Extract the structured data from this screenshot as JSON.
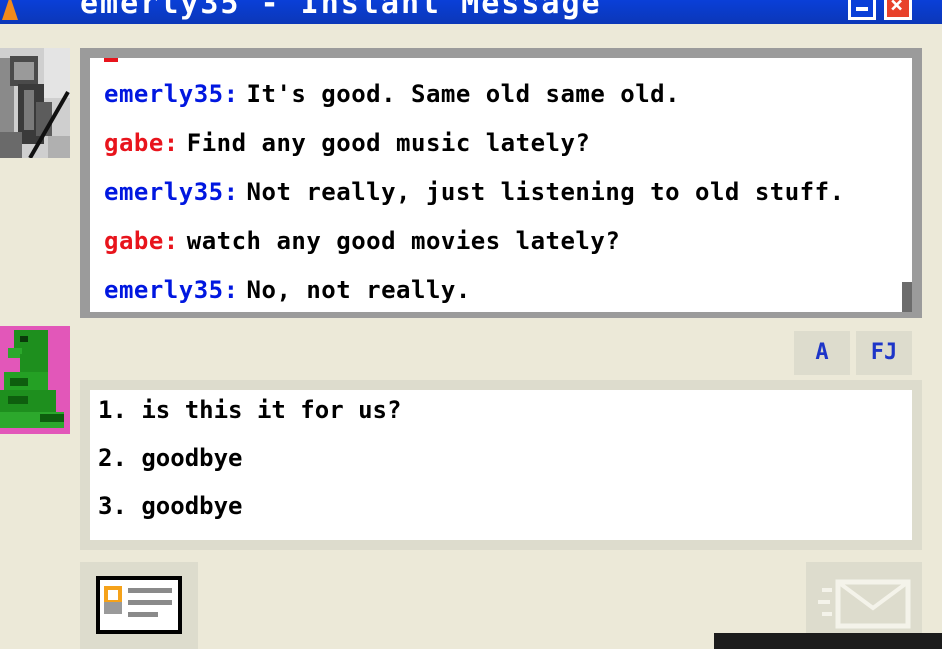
{
  "window": {
    "title": "emerly35 - Instant Message"
  },
  "conversation": {
    "messages": [
      {
        "sender": "emerly35:",
        "text": "It's good. Same old same old."
      },
      {
        "sender": "gabe:",
        "text": "Find any good music lately?"
      },
      {
        "sender": "emerly35:",
        "text": "Not really, just listening to old stuff."
      },
      {
        "sender": "gabe:",
        "text": "watch any good movies lately?"
      },
      {
        "sender": "emerly35:",
        "text": "No, not really."
      }
    ]
  },
  "toolbar": {
    "font_label": "A",
    "emoticon_label": "FJ"
  },
  "reply_options": [
    "1. is this it for us?",
    "2. goodbye",
    "3. goodbye"
  ],
  "colors": {
    "buddy_name": "#0017e0",
    "self_name": "#e8141c",
    "titlebar": "#0a3fd8",
    "window_bg": "#ece9d8"
  },
  "icons": {
    "profile": "profile-card-icon",
    "send": "send-envelope-icon",
    "minimize": "minimize-icon",
    "close": "close-icon"
  }
}
